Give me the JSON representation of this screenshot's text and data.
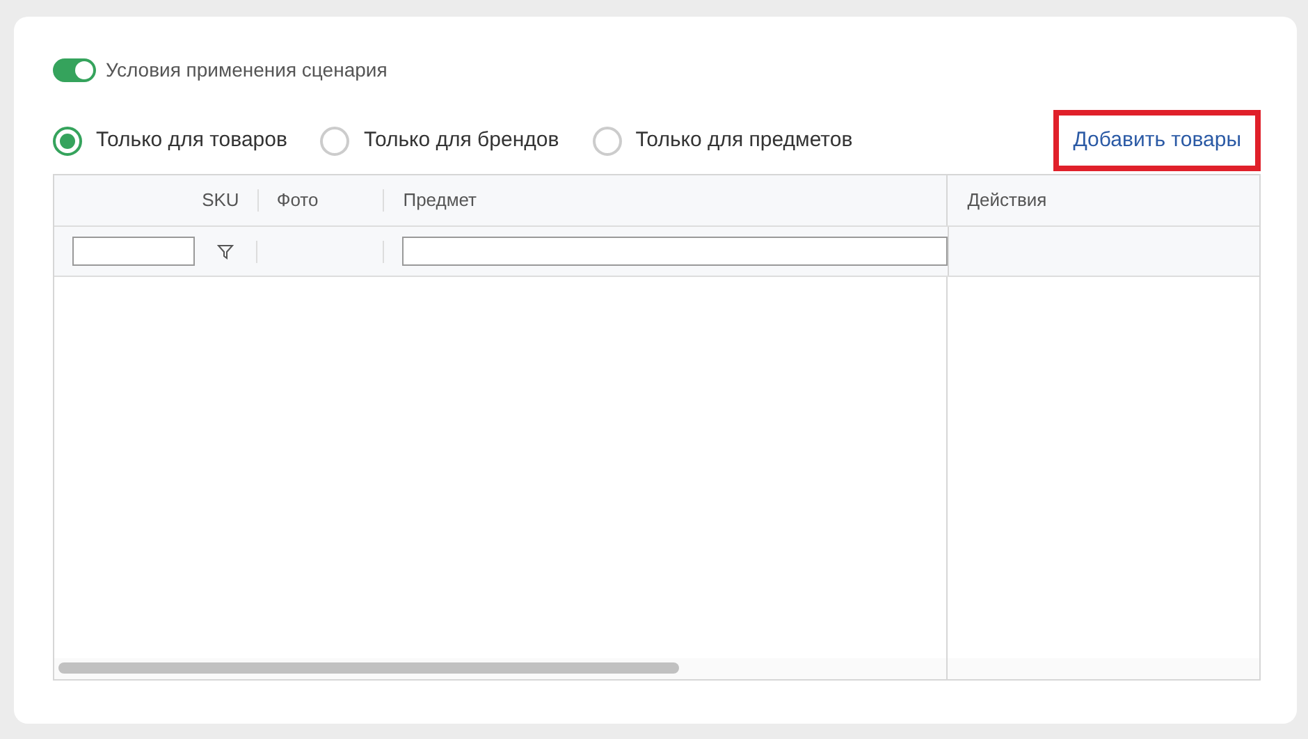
{
  "toggle": {
    "label": "Условия применения сценария",
    "on": true
  },
  "scope_options": [
    {
      "label": "Только для товаров",
      "selected": true
    },
    {
      "label": "Только для брендов",
      "selected": false
    },
    {
      "label": "Только для предметов",
      "selected": false
    }
  ],
  "add_link": {
    "label": "Добавить товары",
    "highlighted": true
  },
  "table": {
    "columns": [
      {
        "label": "SKU",
        "kind": "sku"
      },
      {
        "label": "Фото",
        "kind": "photo"
      },
      {
        "label": "Предмет",
        "kind": "subject"
      },
      {
        "label": "Действия",
        "kind": "actions"
      }
    ]
  }
}
